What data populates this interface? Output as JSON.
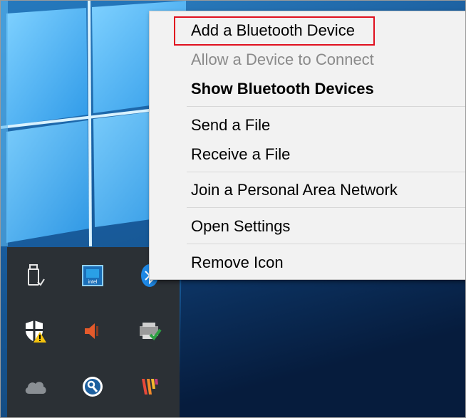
{
  "menu": {
    "items": [
      {
        "label": "Add a Bluetooth Device"
      },
      {
        "label": "Allow a Device to Connect"
      },
      {
        "label": "Show Bluetooth Devices"
      },
      {
        "label": "Send a File"
      },
      {
        "label": "Receive a File"
      },
      {
        "label": "Join a Personal Area Network"
      },
      {
        "label": "Open Settings"
      },
      {
        "label": "Remove Icon"
      }
    ],
    "highlight_color": "#e0101f"
  },
  "tray": {
    "icons": [
      "usb-drive-icon",
      "intel-graphics-icon",
      "bluetooth-icon",
      "windows-defender-warning-icon",
      "speaker-muted-icon",
      "network-printer-icon",
      "onedrive-cloud-icon",
      "key-search-icon",
      "app-logo-icon"
    ]
  },
  "colors": {
    "wallpaper_light": "#3ea6ea",
    "wallpaper_dark": "#0a2a52",
    "tray_background": "#2b3035",
    "menu_background": "#f2f2f2"
  }
}
